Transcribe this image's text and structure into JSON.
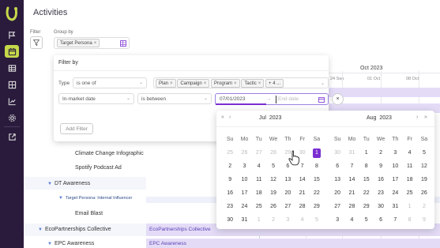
{
  "page": {
    "title": "Activities"
  },
  "toolbar": {
    "filter_label": "Filter",
    "groupby_label": "Group by",
    "groupby_chip": "Target Persona",
    "chip_remove": "×"
  },
  "gantt": {
    "month": "Oct 2023",
    "dates": [
      "24 Sep",
      "01 Oct",
      "08 Oct"
    ],
    "rows": [
      {
        "label": "Climate Change Infographic",
        "bar": ""
      },
      {
        "label": "Spotify Podcast Ad",
        "bar": ""
      },
      {
        "label": "DT Awareness",
        "bar": ""
      },
      {
        "label": "Target Persona: Internal Influencer",
        "bar": ""
      },
      {
        "label": "Email Blast",
        "bar": ""
      },
      {
        "label": "EcoPartnerships Collective",
        "bar": "EcoPartnerships Collective"
      },
      {
        "label": "EPC Awareness",
        "bar": "EPC Awareness"
      }
    ]
  },
  "filter_panel": {
    "title": "Filter by",
    "row1": {
      "field": "Type",
      "operator": "is one of",
      "chips": [
        "Plan",
        "Campaign",
        "Program",
        "Tactic"
      ],
      "more": "+ 4 ..."
    },
    "row2": {
      "field": "In-market date",
      "operator": "is between",
      "start_value": "07/01/2023",
      "separator": "→",
      "end_placeholder": "End date"
    },
    "clear": "×",
    "add_filter": "Add Filter"
  },
  "calendar": {
    "nav": {
      "prev_year": "«",
      "prev_month": "‹",
      "next_month": "›",
      "next_year": "»"
    },
    "weekdays": [
      "Su",
      "Mo",
      "Tu",
      "We",
      "Th",
      "Fr",
      "Sa"
    ],
    "left": {
      "month": "Jul",
      "year": "2023",
      "days": [
        [
          "25",
          "26",
          "27",
          "28",
          "29",
          "30",
          "1"
        ],
        [
          "2",
          "3",
          "4",
          "5",
          "6",
          "7",
          "8"
        ],
        [
          "9",
          "10",
          "11",
          "12",
          "13",
          "14",
          "15"
        ],
        [
          "16",
          "17",
          "18",
          "19",
          "20",
          "21",
          "22"
        ],
        [
          "23",
          "24",
          "25",
          "26",
          "27",
          "28",
          "29"
        ],
        [
          "30",
          "31",
          "1",
          "2",
          "3",
          "4",
          "5"
        ]
      ],
      "muted_first_row": 6,
      "muted_last_row_from": 2,
      "selected": [
        0,
        6
      ]
    },
    "right": {
      "month": "Aug",
      "year": "2023",
      "days": [
        [
          "30",
          "31",
          "1",
          "2",
          "3",
          "4",
          "5"
        ],
        [
          "6",
          "7",
          "8",
          "9",
          "10",
          "11",
          "12"
        ],
        [
          "13",
          "14",
          "15",
          "16",
          "17",
          "18",
          "19"
        ],
        [
          "20",
          "21",
          "22",
          "23",
          "24",
          "25",
          "26"
        ],
        [
          "27",
          "28",
          "29",
          "30",
          "31",
          "1",
          "2"
        ],
        [
          "3",
          "4",
          "5",
          "6",
          "7",
          "8",
          "9"
        ]
      ],
      "muted_first_row": 2,
      "muted_last_row_from": 5
    }
  },
  "colors": {
    "sidebar": "#2a1b3d",
    "accent": "#7b2fd1",
    "active_nav": "#c5d84a"
  }
}
